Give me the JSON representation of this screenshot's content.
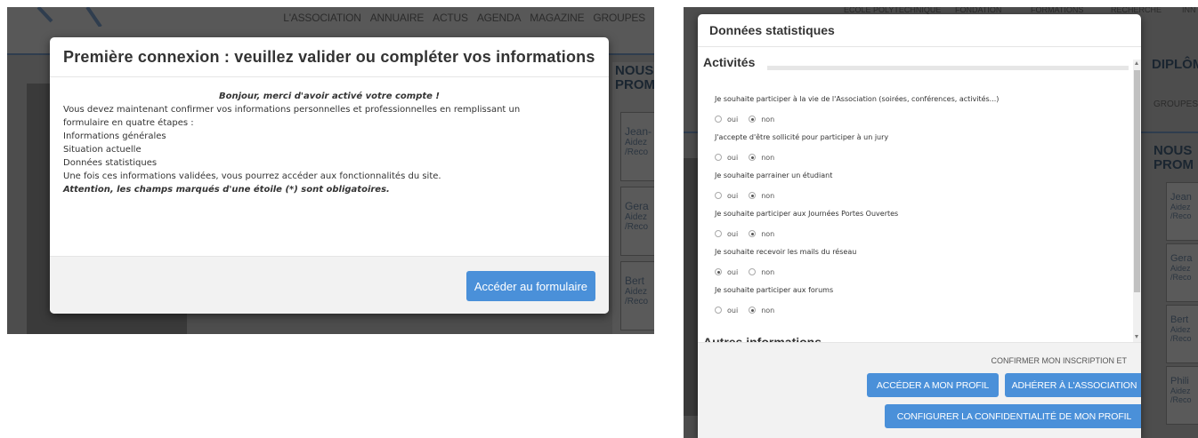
{
  "left": {
    "nav": [
      "L'ASSOCIATION",
      "ANNUAIRE",
      "ACTUS",
      "AGENDA",
      "MAGAZINE",
      "GROUPES"
    ],
    "sidebar_title": "NOUS PROM",
    "cards": [
      {
        "name": "Jean-",
        "sub": "Aidez /Reco"
      },
      {
        "name": "Gera",
        "sub": "Aidez /Reco"
      },
      {
        "name": "Bert",
        "sub": "Aidez /Reco"
      }
    ],
    "modal": {
      "title": "Première connexion : veuillez valider ou compléter vos informations",
      "greeting": "Bonjour, merci d'avoir activé votre compte !",
      "lines": [
        "Vous devez maintenant confirmer vos informations personnelles et professionnelles en remplissant un",
        "formulaire en quatre étapes :",
        "Informations générales",
        "Situation actuelle",
        "Données statistiques",
        "Une fois ces informations validées, vous pourrez accéder aux fonctionnalités du site."
      ],
      "warning": "Attention, les champs marqués d'une étoile (*) sont obligatoires.",
      "button": "Accéder au formulaire"
    }
  },
  "right": {
    "nav": [
      "ÉCOLE POLYTECHNIQUE",
      "FONDATION",
      "FORMATIONS",
      "RECHERCHE",
      "INN"
    ],
    "diplo": "DIPLÔM",
    "groupes": "GROUPES",
    "sidebar_title": "NOUS PROM",
    "cards": [
      {
        "name": "Jean",
        "sub": "Aidez /Reco"
      },
      {
        "name": "Gera",
        "sub": "Aidez /Reco"
      },
      {
        "name": "Bert",
        "sub": "Aidez /Reco"
      },
      {
        "name": "Phili",
        "sub": "Aidez /Reco"
      }
    ],
    "modal": {
      "title": "Données statistiques",
      "section": "Activités",
      "questions": [
        {
          "label": "Je souhaite participer à la vie de l'Association (soirées, conférences, activités...)",
          "selected": "non"
        },
        {
          "label": "J'accepte d'être sollicité pour participer à un jury",
          "selected": "non"
        },
        {
          "label": "Je souhaite parrainer un étudiant",
          "selected": "non"
        },
        {
          "label": "Je souhaite participer aux Journées Portes Ouvertes",
          "selected": "non"
        },
        {
          "label": "Je souhaite recevoir les mails du réseau",
          "selected": "oui"
        },
        {
          "label": "Je souhaite participer aux forums",
          "selected": "non"
        }
      ],
      "option_yes": "oui",
      "option_no": "non",
      "next_section": "Autres informations",
      "confirm_text": "CONFIRMER MON INSCRIPTION ET",
      "buttons": {
        "profile": "ACCÉDER A MON PROFIL",
        "adhere": "ADHÉRER À L'ASSOCIATION",
        "privacy": "CONFIGURER LA CONFIDENTIALITÉ DE MON PROFIL"
      }
    }
  }
}
